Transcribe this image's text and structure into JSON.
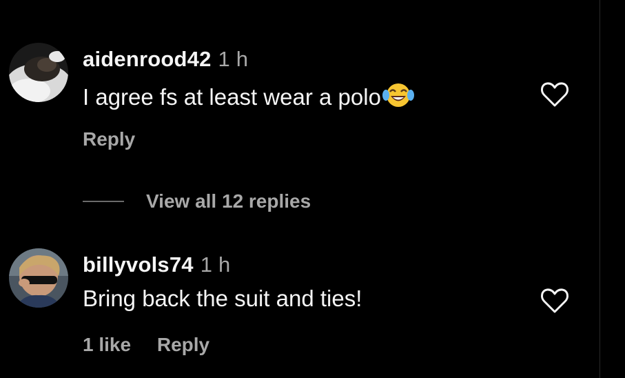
{
  "comments": [
    {
      "username": "aidenrood42",
      "time": "1 h",
      "text": "I agree fs at least wear a polo",
      "emoji": "face-with-tears-of-joy",
      "like_count": "",
      "reply_label": "Reply"
    },
    {
      "username": "billyvols74",
      "time": "1 h",
      "text": "Bring back the suit and ties!",
      "like_count": "1 like",
      "reply_label": "Reply"
    }
  ],
  "view_replies_label": "View all 12 replies",
  "icons": {
    "like": "heart-outline-icon"
  },
  "colors": {
    "background": "#000000",
    "primary_text": "#f5f5f5",
    "secondary_text": "#a8a8a8"
  }
}
